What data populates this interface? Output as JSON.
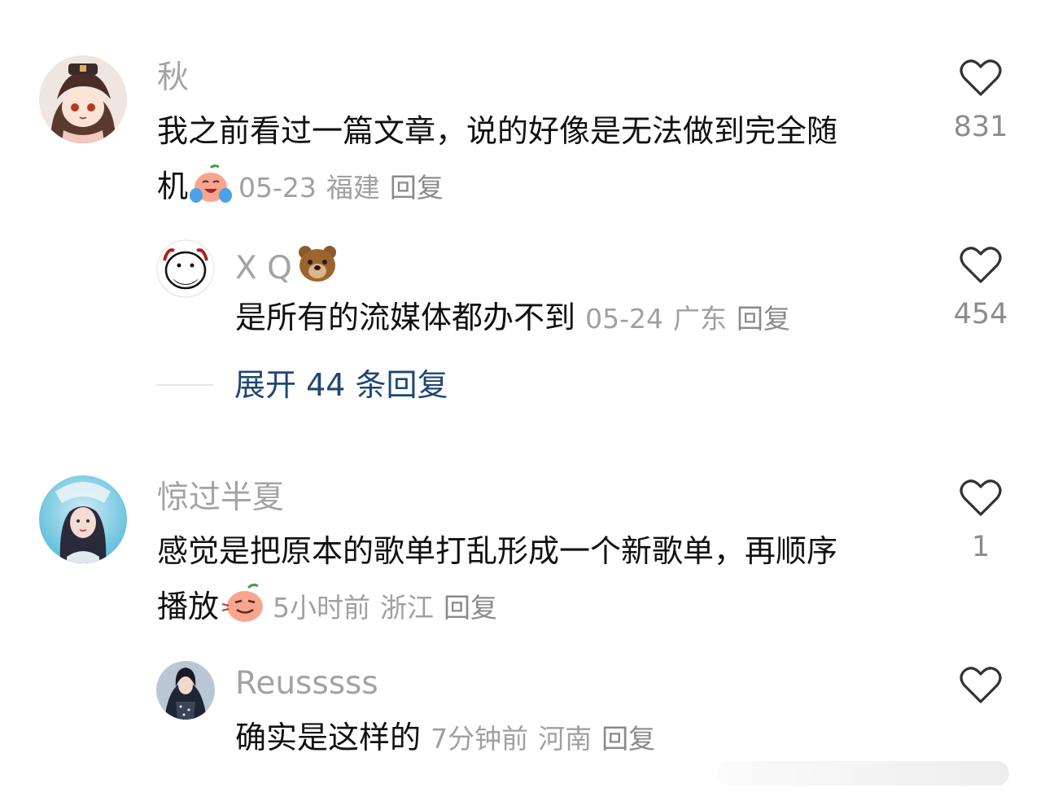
{
  "comments": [
    {
      "username": "秋",
      "text_line1": "我之前看过一篇文章，说的好像是无法做到完全随",
      "text_line2": "机",
      "emoji": "crying-laughing-peach-emoji",
      "time": "05-23",
      "location": "福建",
      "reply_label": "回复",
      "likes": "831",
      "replies": [
        {
          "username": "X Q",
          "username_emoji": "bear-face-emoji",
          "text": "是所有的流媒体都办不到",
          "time": "05-24",
          "location": "广东",
          "reply_label": "回复",
          "likes": "454"
        }
      ],
      "expand_label": "展开 44 条回复"
    },
    {
      "username": "惊过半夏",
      "text_line1": "感觉是把原本的歌单打乱形成一个新歌单，再顺序",
      "text_line2": "播放",
      "emoji": "smug-peach-emoji",
      "time": "5小时前",
      "location": "浙江",
      "reply_label": "回复",
      "likes": "1",
      "replies": [
        {
          "username": "Reusssss",
          "text": "确实是这样的",
          "time": "7分钟前",
          "location": "河南",
          "reply_label": "回复"
        }
      ]
    }
  ],
  "icons": {
    "like": "heart-outline-icon"
  },
  "colors": {
    "username": "#a3a3a3",
    "text": "#111111",
    "meta": "#a0a0a0",
    "expand": "#1e4675",
    "heart": "#333333"
  }
}
